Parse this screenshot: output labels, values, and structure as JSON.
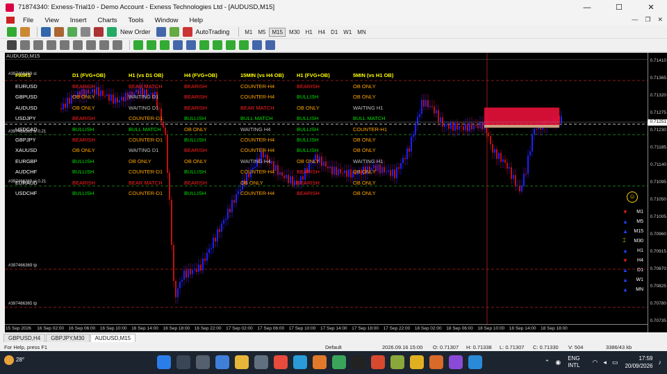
{
  "window": {
    "title": "71874340: Exness-Trial10 - Demo Account - Exness Technologies Ltd - [AUDUSD,M15]",
    "minimize": "—",
    "maximize": "☐",
    "close": "✕"
  },
  "menu": {
    "items": [
      "File",
      "View",
      "Insert",
      "Charts",
      "Tools",
      "Window",
      "Help"
    ],
    "mdi": [
      "—",
      "❐",
      "✕"
    ]
  },
  "toolbar": {
    "new_order": "New Order",
    "auto_trading": "AutoTrading",
    "timeframes": [
      "M1",
      "M5",
      "M15",
      "M30",
      "H1",
      "H4",
      "D1",
      "W1",
      "MN"
    ],
    "active_timeframe": "M15"
  },
  "chart": {
    "symbol_title": "AUDUSD,M15",
    "price_ticks": [
      "0.71410",
      "0.71365",
      "0.71320",
      "0.71275",
      "0.71230",
      "0.71185",
      "0.71140",
      "0.71095",
      "0.71050",
      "0.71005",
      "0.70960",
      "0.70915",
      "0.70870",
      "0.70825",
      "0.70780",
      "0.70735"
    ],
    "current_price": "0.71251",
    "time_labels": [
      "15 Sep 2026",
      "16 Sep 02:00",
      "16 Sep 06:00",
      "16 Sep 10:00",
      "16 Sep 14:00",
      "16 Sep 18:00",
      "16 Sep 22:00",
      "17 Sep 02:00",
      "17 Sep 06:00",
      "17 Sep 10:00",
      "17 Sep 14:00",
      "17 Sep 18:00",
      "17 Sep 22:00",
      "18 Sep 02:00",
      "18 Sep 06:00",
      "18 Sep 10:00",
      "18 Sep 14:00",
      "18 Sep 18:00"
    ],
    "level_labels": [
      "#397466369 sl",
      "#397466365 sl 0.21",
      "#397466369 sl 0.21",
      "#397466369 tp",
      "#397466365 tp"
    ],
    "table": {
      "headers": [
        "PAIRS",
        "D1 (FVG+OB)",
        "H1 (vs D1 OB)",
        "H4 (FVG+OB)",
        "15MIN (vs H4 OB)",
        "H1 (FVG+OB)",
        "5MIN (vs H1 OB)"
      ],
      "rows": [
        [
          "EURUSD",
          "BEARISH",
          "BEAR MATCH",
          "BEARISH",
          "COUNTER-H4",
          "BEARISH",
          "OB ONLY"
        ],
        [
          "GBPUSD",
          "OB ONLY",
          "WAITING D1",
          "BEARISH",
          "COUNTER-H4",
          "BULLISH",
          "OB ONLY"
        ],
        [
          "AUDUSD",
          "OB ONLY",
          "WAITING D1",
          "BEARISH",
          "BEAR MATCH",
          "OB ONLY",
          "WAITING H1"
        ],
        [
          "USDJPY",
          "BEARISH",
          "COUNTER-D1",
          "BULLISH",
          "BULL MATCH",
          "BULLISH",
          "BULL MATCH"
        ],
        [
          "USDCAD",
          "BULLISH",
          "BULL MATCH",
          "OB ONLY",
          "WAITING H4",
          "BULLISH",
          "COUNTER-H1"
        ],
        [
          "GBPJPY",
          "BEARISH",
          "COUNTER-D1",
          "BULLISH",
          "COUNTER-H4",
          "BULLISH",
          "OB ONLY"
        ],
        [
          "XAUUSD",
          "OB ONLY",
          "WAITING D1",
          "BEARISH",
          "COUNTER-H4",
          "BULLISH",
          "OB ONLY"
        ],
        [
          "EURGBP",
          "BULLISH",
          "OB ONLY",
          "OB ONLY",
          "WAITING H4",
          "OB ONLY",
          "WAITING H1"
        ],
        [
          "AUDCHF",
          "BULLISH",
          "COUNTER-D1",
          "BULLISH",
          "COUNTER-H4",
          "BEARISH",
          "OB ONLY"
        ],
        [
          "EURAUD",
          "BEARISH",
          "BEAR MATCH",
          "BEARISH",
          "OB ONLY",
          "BEARISH",
          "OB ONLY"
        ],
        [
          "USDCHF",
          "BULLISH",
          "COUNTER-D1",
          "BULLISH",
          "COUNTER-H4",
          "BEARISH",
          "OB ONLY"
        ]
      ]
    },
    "colors": {
      "bullish": "#00e000",
      "bearish": "#ff2020",
      "neutral": "#ffa500",
      "grey": "#c0c0c0",
      "header": "#ffff00",
      "bull_candle": "#2020ff",
      "bear_candle": "#c01010",
      "zone": "#e8103a"
    },
    "tf_panel": [
      {
        "label": "M1",
        "dir": "down"
      },
      {
        "label": "M5",
        "dir": "up"
      },
      {
        "label": "M15",
        "dir": "up"
      },
      {
        "label": "M30",
        "dir": "neutral"
      },
      {
        "label": "H1",
        "dir": "up"
      },
      {
        "label": "H4",
        "dir": "down"
      },
      {
        "label": "D1",
        "dir": "up"
      },
      {
        "label": "W1",
        "dir": "up"
      },
      {
        "label": "MN",
        "dir": "up"
      }
    ]
  },
  "tabs": [
    "GBPUSD,H4",
    "GBPJPY,M30",
    "AUDUSD,M15"
  ],
  "active_tab": "AUDUSD,M15",
  "status": {
    "help": "For Help, press F1",
    "profile": "Default",
    "time": "2026.09.16 15:00",
    "open": "O: 0.71307",
    "high": "H: 0.71338",
    "low": "L: 0.71307",
    "close": "C: 0.71330",
    "volume": "V: 504",
    "traffic": "3386/43 kb"
  },
  "taskbar": {
    "temp": "28°",
    "lang_top": "ENG",
    "lang_bottom": "INTL",
    "time": "17:59",
    "date": "20/09/2026"
  }
}
